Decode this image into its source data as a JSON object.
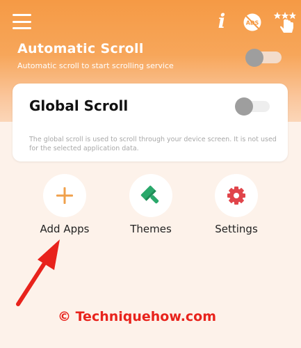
{
  "header": {
    "menu_icon": "hamburger-menu-icon",
    "info_icon": "info-icon",
    "info_glyph": "i",
    "no_ads_icon": "no-ads-icon",
    "no_ads_text": "ADS",
    "gesture_icon": "star-hand-gesture-icon"
  },
  "automatic_scroll": {
    "title": "Automatic Scroll",
    "subtitle": "Automatic scroll to start scrolling service",
    "enabled": false
  },
  "global_scroll": {
    "title": "Global Scroll",
    "description": "The global scroll is used to scroll through your device screen. It is not used for the selected application data.",
    "enabled": false
  },
  "actions": [
    {
      "label": "Add Apps",
      "icon": "plus-icon",
      "color": "#f0a04b"
    },
    {
      "label": "Themes",
      "icon": "paint-brush-icon",
      "color": "#2aa86b"
    },
    {
      "label": "Settings",
      "icon": "gear-icon",
      "color": "#e0454b"
    }
  ],
  "watermark": "© Techniquehow.com",
  "colors": {
    "header_orange": "#f59a45",
    "background": "#fdf2ea",
    "toggle_knob_off": "#9e9e9e",
    "annotation_red": "#e8231c"
  }
}
